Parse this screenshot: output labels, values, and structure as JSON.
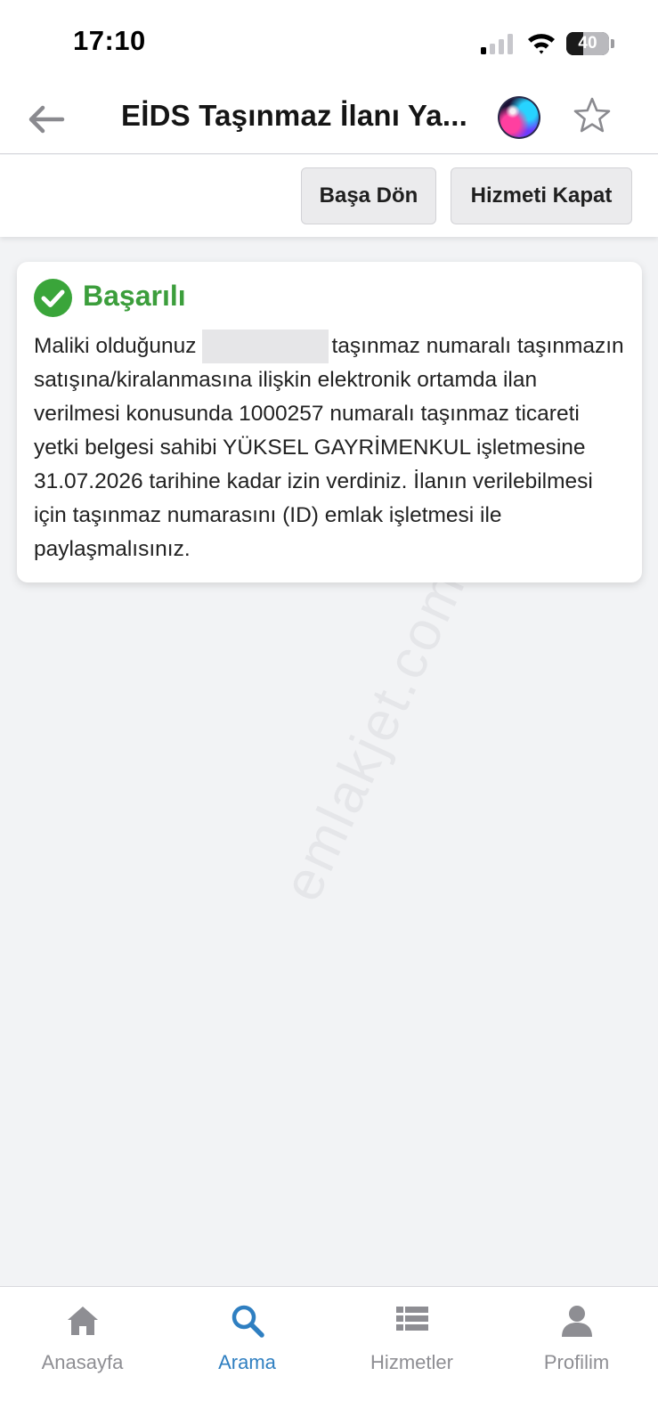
{
  "status_bar": {
    "time": "17:10",
    "battery_percent": "40",
    "battery_level": 0.4,
    "signal_bars_on": 1,
    "signal_bars_total": 4
  },
  "header": {
    "title": "EİDS Taşınmaz İlanı Ya...",
    "back_icon": "arrow-left-icon",
    "siri_icon": "siri-icon",
    "favorite_icon": "star-outline-icon"
  },
  "actions": {
    "restart_label": "Başa Dön",
    "close_service_label": "Hizmeti Kapat"
  },
  "result": {
    "status_title": "Başarılı",
    "status_icon": "check-circle-icon",
    "status_color": "#3aa53a",
    "message_before_redaction": "Maliki olduğunuz",
    "message_after_redaction": "taşınmaz numaralı taşınmazın satışına/kiralanmasına ilişkin elektronik ortamda ilan verilmesi konusunda 1000257 numaralı taşınmaz ticareti yetki belgesi sahibi YÜKSEL GAYRİMENKUL işletmesine 31.07.2026 tarihine kadar izin verdiniz. İlanın verilebilmesi için taşınmaz numarasını (ID) emlak işletmesi ile paylaşmalısınız."
  },
  "watermark": "emlakjet.com",
  "tab_bar": {
    "active_color": "#2f7fc1",
    "inactive_color": "#8e8e93",
    "tabs": [
      {
        "label": "Anasayfa",
        "icon": "home-icon",
        "active": false
      },
      {
        "label": "Arama",
        "icon": "search-icon",
        "active": true
      },
      {
        "label": "Hizmetler",
        "icon": "list-icon",
        "active": false
      },
      {
        "label": "Profilim",
        "icon": "user-icon",
        "active": false
      }
    ]
  }
}
